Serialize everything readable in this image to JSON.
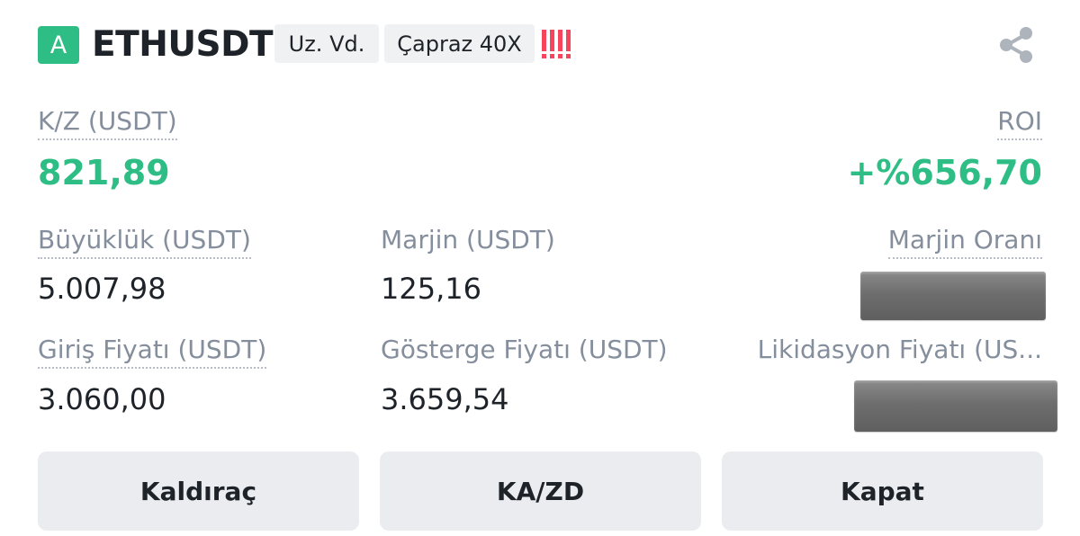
{
  "header": {
    "mode_badge": "A",
    "symbol": "ETHUSDT",
    "contract_tag": "Uz. Vd.",
    "margin_tag": "Çapraz 40X",
    "risk_icon": "risk-bars-icon",
    "share_icon": "share-icon"
  },
  "pnl": {
    "label": "K/Z (USDT)",
    "value": "821,89"
  },
  "roi": {
    "label": "ROI",
    "value": "+%656,70"
  },
  "size": {
    "label": "Büyüklük (USDT)",
    "value": "5.007,98"
  },
  "margin": {
    "label": "Marjin (USDT)",
    "value": "125,16"
  },
  "margin_ratio": {
    "label": "Marjin Oranı"
  },
  "entry_price": {
    "label": "Giriş Fiyatı (USDT)",
    "value": "3.060,00"
  },
  "mark_price": {
    "label": "Gösterge Fiyatı (USDT)",
    "value": "3.659,54"
  },
  "liq_price": {
    "label": "Likidasyon Fiyatı (US..."
  },
  "buttons": {
    "leverage": "Kaldıraç",
    "tpsl": "KA/ZD",
    "close": "Kapat"
  },
  "colors": {
    "profit_green": "#2ebd85",
    "risk_red": "#f6465d",
    "label_gray": "#848e9c",
    "button_bg": "#eaecef"
  }
}
